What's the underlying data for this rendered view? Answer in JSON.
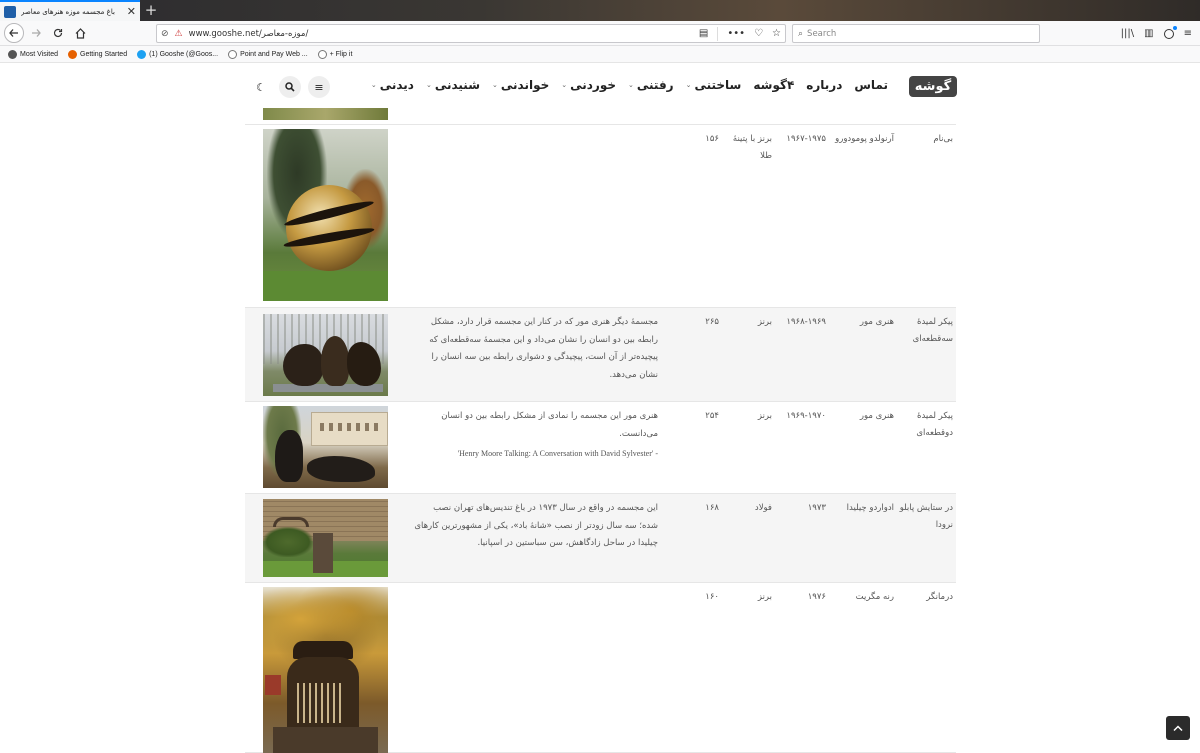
{
  "browser": {
    "tab_title": "باغ مجسمه موزه هنرهای معاصر",
    "tab_close": "✕",
    "new_tab": "+",
    "url": "www.gooshe.net/موزه-معاصر/",
    "search_placeholder": "Search",
    "bookmarks": [
      {
        "label": "Most Visited",
        "icon": "gear-icon",
        "color": "#555555"
      },
      {
        "label": "Getting Started",
        "icon": "firefox-icon",
        "color": "#e66000"
      },
      {
        "label": "(1) Gooshe (@Goos...",
        "icon": "twitter-icon",
        "color": "#1da1f2"
      },
      {
        "label": "Point and Pay Web ...",
        "icon": "globe-icon",
        "color": "#777777"
      },
      {
        "label": "+ Flip it",
        "icon": "globe-icon",
        "color": "#777777"
      }
    ]
  },
  "site": {
    "logo": "گوشه",
    "nav": [
      {
        "label": "دیدنی",
        "dropdown": true
      },
      {
        "label": "شنیدنی",
        "dropdown": true
      },
      {
        "label": "خواندنی",
        "dropdown": true
      },
      {
        "label": "خوردنی",
        "dropdown": true
      },
      {
        "label": "رفتنی",
        "dropdown": true
      },
      {
        "label": "ساختنی",
        "dropdown": true
      },
      {
        "label": "۴گوشه",
        "dropdown": false
      },
      {
        "label": "درباره",
        "dropdown": false
      },
      {
        "label": "تماس",
        "dropdown": false
      }
    ]
  },
  "table": {
    "rows": [
      {
        "name": "بی‌نام",
        "artist": "آرنولدو پومودورو",
        "year": "۱۹۶۷-۱۹۷۵",
        "material": "برنز با پتینهٔ طلا",
        "height": "۱۵۶",
        "desc": "",
        "ref": "",
        "image": "sphere-sculpture"
      },
      {
        "name": "پیکر لمیدهٔ سه‌قطعه‌ای",
        "artist": "هنری مور",
        "year": "۱۹۶۸-۱۹۶۹",
        "material": "برنز",
        "height": "۲۶۵",
        "desc": "مجسمهٔ دیگر هنری مور که در کنار این مجسمه قرار دارد، مشکل رابطه بین دو انسان را نشان می‌داد و این مجسمهٔ سه‌قطعه‌ای که پیچیده‌تر از آن است، پیچیدگی و دشواری رابطه بین سه انسان را نشان می‌دهد.",
        "ref": "",
        "image": "three-piece-reclining-figure"
      },
      {
        "name": "پیکر لمیدهٔ دوقطعه‌ای",
        "artist": "هنری مور",
        "year": "۱۹۶۹-۱۹۷۰",
        "material": "برنز",
        "height": "۲۵۴",
        "desc": "هنری مور این مجسمه را نمادی از مشکل رابطه بین دو انسان می‌دانست.",
        "ref": "'Henry Moore Talking: A Conversation with David Sylvester' -",
        "image": "two-piece-reclining-figure"
      },
      {
        "name": "در ستایش پابلو نرودا",
        "artist": "ادواردو چیلیدا",
        "year": "۱۹۷۳",
        "material": "فولاد",
        "height": "۱۶۸",
        "desc": "این مجسمه در واقع در سال ۱۹۷۳ در باغ تندیس‌های تهران نصب شده؛ سه سال زودتر از نصب «شانهٔ باد»، یکی از مشهورترین کارهای چیلیدا در ساحل زادگاهش، سن سباستین در اسپانیا.",
        "ref": "",
        "image": "chillida-sculpture"
      },
      {
        "name": "درمانگر",
        "artist": "رنه مگریت",
        "year": "۱۹۷۶",
        "material": "برنز",
        "height": "۱۶۰",
        "desc": "",
        "ref": "",
        "image": "magritte-therapist"
      }
    ]
  },
  "colors": {
    "tab_accent": "#0a84ff",
    "logo_bg": "#444444",
    "alt_row": "#f5f5f5"
  }
}
